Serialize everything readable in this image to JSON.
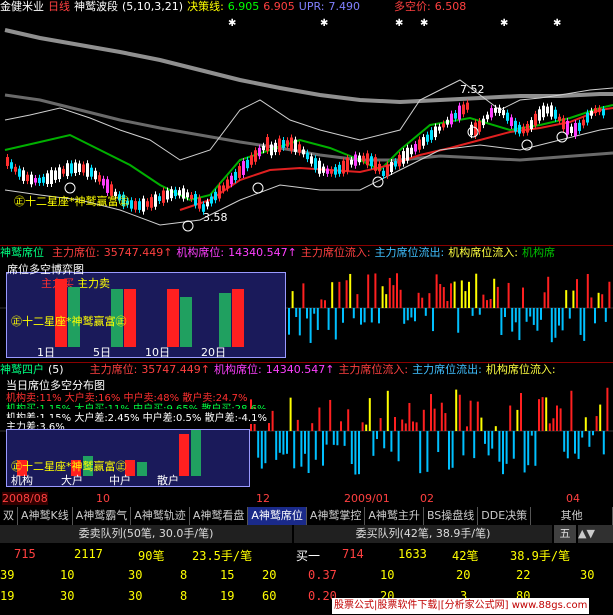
{
  "header": {
    "stock": "金健米业",
    "period": "日线",
    "indicator": "神鹫波段",
    "params": "(5,10,3,21)",
    "decision_label": "决策线:",
    "decision_value": "6.905",
    "decision_value2": "6.905",
    "upr_label": "UPR:",
    "upr_value": "7.490",
    "short_label": "多空价:",
    "short_value": "6.508"
  },
  "main": {
    "high_label": "7.52",
    "low_label": "3.58",
    "watermark": "㊣十二星座*神鹫赢富㊣",
    "zheng_marks": [
      "㊣",
      "㊣",
      "㊣",
      "㊣",
      "㊣",
      "㊣",
      "㊣"
    ]
  },
  "panel2": {
    "title": "神鹫席位",
    "main_seat_label": "主力席位:",
    "main_seat_value": "35747.449↑",
    "inst_seat_label": "机构席位:",
    "inst_seat_value": "14340.547↑",
    "inflow_label": "主力席位流入:",
    "outflow_label": "主力席位流出:",
    "inst_inflow_label": "机构席位流入:",
    "inst_outflow_label": "机构席",
    "popup_title": "席位多空博弈图",
    "popup_sub": "主力买",
    "popup_sub2": "主力卖",
    "popup_watermark": "㊣十二星座*神鹫赢富㊣",
    "popup_labels": [
      "1日",
      "5日",
      "10日",
      "20日"
    ]
  },
  "panel3": {
    "title": "神鹫四户",
    "param": "(5)",
    "main_seat_label": "主力席位:",
    "main_seat_value": "35747.449↑",
    "inst_seat_label": "机构席位:",
    "inst_seat_value": "14340.547↑",
    "inflow_label": "主力席位流入:",
    "outflow_label": "主力席位流出:",
    "inst_inflow_label": "机构席位流入:",
    "popup_title": "当日席位多空分布图",
    "line1": "机构卖:11% 大户卖:16% 中户卖:48% 散户卖:24.7%",
    "line2": "机构买:1.15% 大户买:11% 中户买:9.65% 散户买:28.6%",
    "line3": "机构差:1.15% 大户差:2.45% 中户差:0.5% 散户差:-4.1%",
    "line4": "主力差:3.6%",
    "popup_watermark": "㊣十二星座*神鹫赢富㊣",
    "popup_labels": [
      "机构",
      "大户",
      "中户",
      "散户"
    ]
  },
  "dates": [
    "2008/08",
    "10",
    "12",
    "2009/01",
    "02",
    "04"
  ],
  "tabs": [
    {
      "label": "双",
      "active": false
    },
    {
      "label": "A神鹫K线",
      "active": false
    },
    {
      "label": "A神鹫霸气",
      "active": false
    },
    {
      "label": "A神鹫轨迹",
      "active": false
    },
    {
      "label": "A神鹫看盘",
      "active": false
    },
    {
      "label": "A神鹫席位",
      "active": true
    },
    {
      "label": "A神鹫掌控",
      "active": false
    },
    {
      "label": "A神鹫主升",
      "active": false
    },
    {
      "label": "BS操盘线",
      "active": false
    },
    {
      "label": "DDE决策",
      "active": false
    },
    {
      "label": "其他",
      "active": false
    }
  ],
  "queue": {
    "sell_title": "委卖队列(50笔, 30.0手/笔)",
    "buy_title": "委买队列(42笔, 38.9手/笔)",
    "five_label": "五",
    "sell_row": {
      "price": "715",
      "vol": "2117",
      "count": "90笔",
      "avg": "23.5手/笔"
    },
    "buy_row": {
      "label": "买一",
      "price": "714",
      "vol": "1633",
      "count": "42笔",
      "avg": "38.9手/笔"
    },
    "sell_grid": [
      [
        "39",
        "10",
        "30",
        "8",
        "15",
        "20"
      ],
      [
        "19",
        "30",
        "30",
        "8",
        "19",
        "60"
      ]
    ],
    "buy_grid": [
      [
        "0.37",
        "10",
        "20",
        "22",
        "30"
      ],
      [
        "0.20",
        "20",
        "3",
        "80",
        ""
      ]
    ],
    "footer": "股票公式|股票软件下载|[分析家公式网] www.88gs.com"
  },
  "colors": {
    "red": "#ff2020",
    "cyan": "#00e0ff",
    "yellow": "#ffff00",
    "green": "#00c000",
    "magenta": "#ff40ff"
  }
}
